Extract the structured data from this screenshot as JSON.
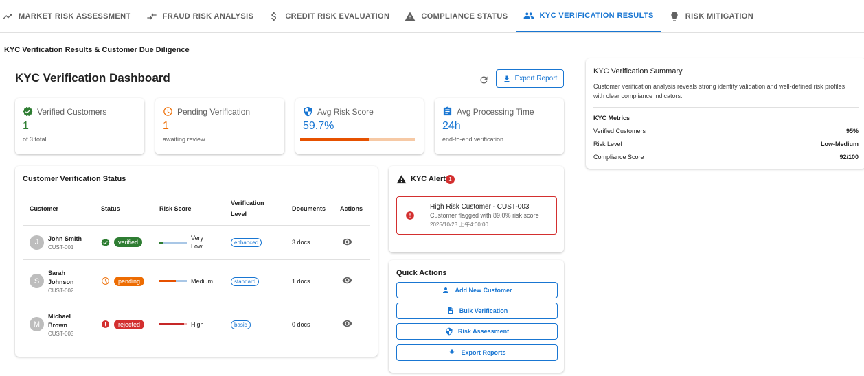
{
  "tabs": [
    {
      "label": "MARKET RISK ASSESSMENT",
      "icon": "trending-up-icon"
    },
    {
      "label": "FRAUD RISK ANALYSIS",
      "icon": "compare-arrows-icon"
    },
    {
      "label": "CREDIT RISK EVALUATION",
      "icon": "dollar-icon"
    },
    {
      "label": "COMPLIANCE STATUS",
      "icon": "warning-icon"
    },
    {
      "label": "KYC VERIFICATION RESULTS",
      "icon": "people-icon",
      "active": true
    },
    {
      "label": "RISK MITIGATION",
      "icon": "lightbulb-icon"
    }
  ],
  "page_subtitle": "KYC Verification Results & Customer Due Diligence",
  "dashboard": {
    "title": "KYC Verification Dashboard",
    "export_label": "Export Report"
  },
  "stats": [
    {
      "label": "Verified Customers",
      "value": "1",
      "sub": "of 3 total",
      "color": "#2e7d32",
      "icon": "verified-icon"
    },
    {
      "label": "Pending Verification",
      "value": "1",
      "sub": "awaiting review",
      "color": "#ed6c02",
      "icon": "clock-icon"
    },
    {
      "label": "Avg Risk Score",
      "value": "59.7%",
      "progress": 0.597,
      "color": "#1976d2",
      "icon": "shield-icon"
    },
    {
      "label": "Avg Processing Time",
      "value": "24h",
      "sub": "end-to-end verification",
      "color": "#1976d2",
      "icon": "clipboard-icon"
    }
  ],
  "customers": {
    "title": "Customer Verification Status",
    "headers": [
      "Customer",
      "Status",
      "Risk Score",
      "Verification Level",
      "Documents",
      "Actions"
    ],
    "rows": [
      {
        "initial": "J",
        "name": "John Smith",
        "id": "CUST-001",
        "status": "verified",
        "status_color": "#2e7d32",
        "risk": "Very Low",
        "risk_level": 0.15,
        "risk_color": "#2e7d32",
        "risk_track": "#a9c7e6",
        "level": "enhanced",
        "docs": "3 docs"
      },
      {
        "initial": "S",
        "name": "Sarah Johnson",
        "id": "CUST-002",
        "status": "pending",
        "status_color": "#ed6c02",
        "risk": "Medium",
        "risk_level": 0.6,
        "risk_color": "#e65100",
        "risk_track": "#a9c7e6",
        "level": "standard",
        "docs": "1 docs"
      },
      {
        "initial": "M",
        "name": "Michael Brown",
        "id": "CUST-003",
        "status": "rejected",
        "status_color": "#d32f2f",
        "risk": "High",
        "risk_level": 0.89,
        "risk_color": "#c62828",
        "risk_track": "#f0b4b4",
        "level": "basic",
        "docs": "0 docs"
      }
    ]
  },
  "alerts": {
    "title": "KYC Alerts",
    "count": "1",
    "items": [
      {
        "title": "High Risk Customer - CUST-003",
        "desc": "Customer flagged with 89.0% risk score",
        "time": "2025/10/23 上午4:00:00"
      }
    ]
  },
  "quick_actions": {
    "title": "Quick Actions",
    "buttons": [
      {
        "label": "Add New Customer",
        "icon": "person-add-icon"
      },
      {
        "label": "Bulk Verification",
        "icon": "document-icon"
      },
      {
        "label": "Risk Assessment",
        "icon": "shield-icon"
      },
      {
        "label": "Export Reports",
        "icon": "download-icon"
      }
    ]
  },
  "summary": {
    "title": "KYC Verification Summary",
    "text": "Customer verification analysis reveals strong identity validation and well-defined risk profiles with clear compliance indicators.",
    "metrics_title": "KYC Metrics",
    "metrics": [
      {
        "label": "Verified Customers",
        "value": "95%"
      },
      {
        "label": "Risk Level",
        "value": "Low-Medium"
      },
      {
        "label": "Compliance Score",
        "value": "92/100"
      }
    ]
  }
}
